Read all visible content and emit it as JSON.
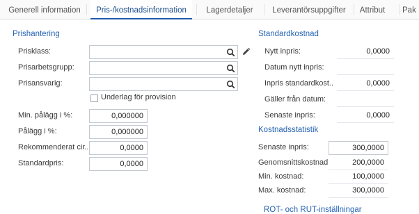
{
  "tabs": [
    {
      "label": "Generell information"
    },
    {
      "label": "Pris-/kostnadsinformation"
    },
    {
      "label": "Lagerdetaljer"
    },
    {
      "label": "Leverantörsuppgifter"
    },
    {
      "label": "Attribut"
    },
    {
      "label": "Pak"
    }
  ],
  "active_tab": 1,
  "prishantering": {
    "title": "Prishantering",
    "prisklass_label": "Prisklass:",
    "prisklass_value": "",
    "prisarbetsgrupp_label": "Prisarbetsgrupp:",
    "prisarbetsgrupp_value": "",
    "prisansvarig_label": "Prisansvarig:",
    "prisansvarig_value": "",
    "underlag_label": "Underlag för provision",
    "underlag_checked": false,
    "min_palagg_label": "Min. pålägg i %:",
    "min_palagg_value": "0,000000",
    "palagg_label": "Pålägg i %:",
    "palagg_value": "0,000000",
    "rekommenderat_label": "Rekommenderat cir...",
    "rekommenderat_value": "0,0000",
    "standardpris_label": "Standardpris:",
    "standardpris_value": "0,0000"
  },
  "standardkostnad": {
    "title": "Standardkostnad",
    "nytt_inpris_label": "Nytt inpris:",
    "nytt_inpris_value": "0,0000",
    "datum_nytt_label": "Datum nytt inpris:",
    "datum_nytt_value": "",
    "inpris_std_label": "Inpris standardkost...",
    "inpris_std_value": "0,0000",
    "galler_label": "Gäller från datum:",
    "galler_value": "",
    "senaste_label": "Senaste inpris:",
    "senaste_value": "0,0000"
  },
  "kostnadsstatistik": {
    "title": "Kostnadsstatistik",
    "senaste_label": "Senaste inpris:",
    "senaste_value": "300,0000",
    "genomsnitt_label": "Genomsnittskostnad:",
    "genomsnitt_value": "200,0000",
    "min_label": "Min. kostnad:",
    "min_value": "100,0000",
    "max_label": "Max. kostnad:",
    "max_value": "300,0000"
  },
  "rot_rut": {
    "title": "ROT- och RUT-inställningar"
  },
  "icons": {
    "lookup": "search-icon",
    "edit": "pencil-icon"
  },
  "colors": {
    "accent": "#1e5aa8",
    "section_title": "#2764b5"
  }
}
